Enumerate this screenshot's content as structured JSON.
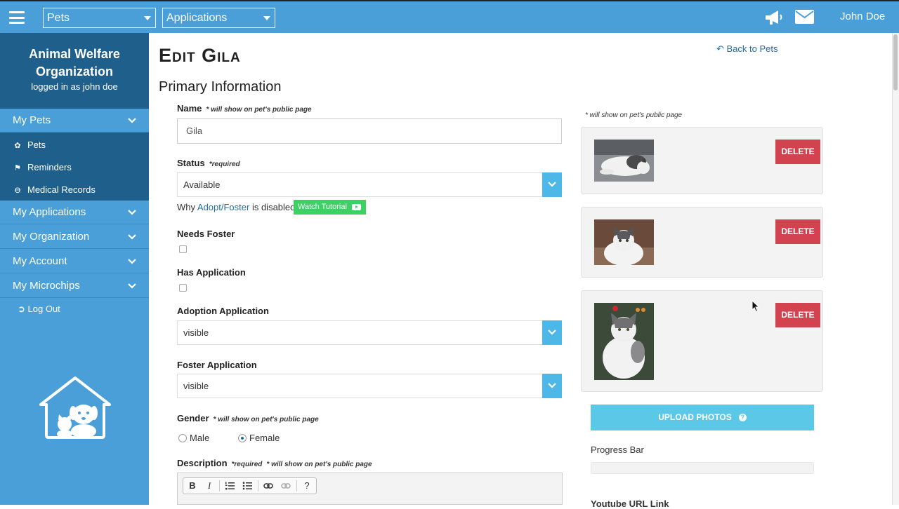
{
  "topbar": {
    "pets_select": "Pets",
    "applications_select": "Applications",
    "user_name": "John Doe"
  },
  "sidebar": {
    "org_name": "Animal Welfare Organization",
    "logged_in": "logged in as john doe",
    "sections": [
      {
        "label": "My Pets"
      },
      {
        "label": "My Applications"
      },
      {
        "label": "My Organization"
      },
      {
        "label": "My Account"
      },
      {
        "label": "My Microchips"
      }
    ],
    "pet_items": [
      {
        "label": "Pets",
        "icon": "paw-icon"
      },
      {
        "label": "Reminders",
        "icon": "flag-icon"
      },
      {
        "label": "Medical Records",
        "icon": "stethoscope-icon"
      }
    ],
    "logout": "Log Out"
  },
  "page": {
    "title": "Edit Gila",
    "back": "Back to Pets",
    "section": "Primary Information"
  },
  "form": {
    "name_label": "Name",
    "name_note": "* will show on pet's public page",
    "name_value": "Gila",
    "status_label": "Status",
    "status_note": "*required",
    "status_value": "Available",
    "helper_pre": "Why ",
    "helper_link": "Adopt/Foster",
    "helper_post": " is disabled",
    "tutorial": "Watch Tutorial",
    "needs_foster_label": "Needs Foster",
    "has_application_label": "Has Application",
    "adoption_label": "Adoption Application",
    "adoption_value": "visible",
    "foster_label": "Foster Application",
    "foster_value": "visible",
    "gender_label": "Gender",
    "gender_note": "* will show on pet's public page",
    "gender_male": "Male",
    "gender_female": "Female",
    "gender_selected": "Female",
    "description_label": "Description",
    "description_note1": "*required",
    "description_note2": "* will show on pet's public page",
    "toolbar": {
      "bold": "B",
      "italic": "I",
      "help": "?"
    }
  },
  "photos": {
    "note": "* will show on pet's public page",
    "delete": "DELETE",
    "upload": "UPLOAD PHOTOS",
    "upload_help": "?",
    "progress_label": "Progress Bar",
    "progress": 0,
    "youtube_label": "Youtube URL Link"
  },
  "colors": {
    "topbar": "#4a9fd8",
    "sidebar_dark": "#1f5f8c",
    "delete": "#d3434f",
    "upload": "#5bc8e8",
    "tutorial": "#3cd065"
  }
}
